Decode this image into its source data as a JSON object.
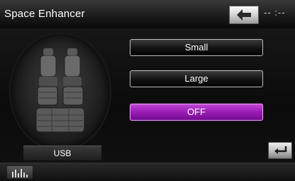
{
  "header": {
    "title": "Space Enhancer",
    "extra_text": "-- :--",
    "back_icon": "back-arrow-icon"
  },
  "seat_graphic": {
    "icon": "car-seat-icon"
  },
  "source": {
    "label": "USB"
  },
  "options": [
    {
      "label": "Small",
      "selected": false
    },
    {
      "label": "Large",
      "selected": false
    },
    {
      "label": "OFF",
      "selected": true
    }
  ],
  "return_button": {
    "icon": "return-icon"
  },
  "bottom_bar": {
    "eq_icon": "equalizer-icon"
  },
  "colors": {
    "selected_accent": "#9a1cb6",
    "button_border": "#bfbfbf",
    "background": "#0b0b0b"
  }
}
